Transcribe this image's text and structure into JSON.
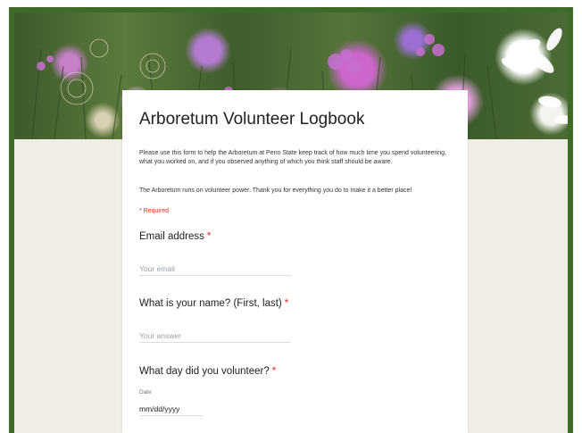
{
  "form": {
    "title": "Arboretum Volunteer Logbook",
    "description": "Please use this form to help the Arboretum at Penn State keep track of how much time you spend volunteering, what you worked on, and if you observed anything of which you think staff should be aware.",
    "description_2": "The Arboretum runs on volunteer power.  Thank you for everything you do to make it a better place!",
    "required_note": "* Required"
  },
  "questions": {
    "email": {
      "label": "Email address",
      "required_mark": "*",
      "placeholder": "Your email"
    },
    "name": {
      "label": "What is your name? (First, last)",
      "required_mark": "*",
      "placeholder": "Your answer"
    },
    "date": {
      "label": "What day did you volunteer?",
      "required_mark": "*",
      "sub_label": "Date",
      "value": "mm/dd/yyyy"
    }
  },
  "colors": {
    "frame": "#3f6b2a",
    "required": "#d93025",
    "background": "#f0ece6"
  }
}
